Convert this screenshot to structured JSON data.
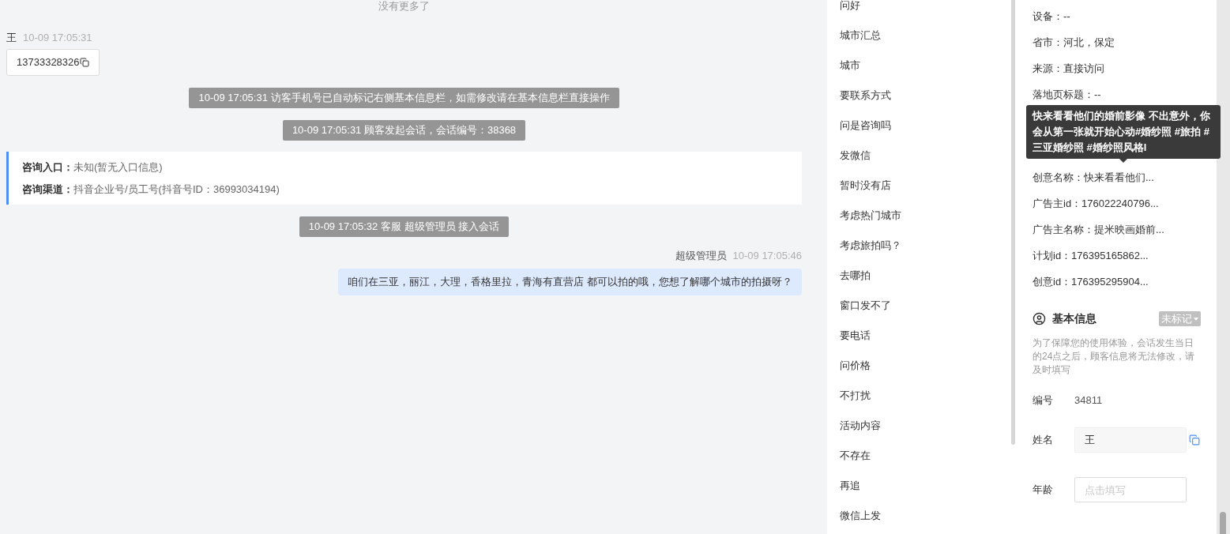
{
  "chat": {
    "notice": "没有更多了",
    "messages": [
      {
        "kind": "visitor",
        "name": "王",
        "time": "10-09 17:05:31",
        "text": "13733328326"
      },
      {
        "kind": "system",
        "text": "10-09 17:05:31 访客手机号已自动标记右侧基本信息栏，如需修改请在基本信息栏直接操作"
      },
      {
        "kind": "system",
        "text": "10-09 17:05:31 顾客发起会话，会话编号：38368"
      },
      {
        "kind": "info",
        "lines": [
          {
            "label": "咨询入口：",
            "value": "未知(暂无入口信息)"
          },
          {
            "label": "咨询渠道：",
            "value": "抖音企业号/员工号(抖音号ID：36993034194)"
          }
        ]
      },
      {
        "kind": "system",
        "text": "10-09 17:05:32 客服 超级管理员 接入会话"
      },
      {
        "kind": "agent",
        "name": "超级管理员",
        "time": "10-09 17:05:46",
        "text": "咱们在三亚，丽江，大理，香格里拉，青海有直营店 都可以拍的哦，您想了解哪个城市的拍摄呀？"
      }
    ]
  },
  "quick_replies": [
    "问好",
    "城市汇总",
    "城市",
    "要联系方式",
    "问是咨询吗",
    "发微信",
    "暂时没有店",
    "考虑热门城市",
    "考虑旅拍吗？",
    "去哪拍",
    "窗口发不了",
    "要电话",
    "问价格",
    "不打扰",
    "活动内容",
    "不存在",
    "再追",
    "微信上发"
  ],
  "profile": {
    "meta_top": [
      "设备：--",
      "省市：河北，保定",
      "来源：直接访问",
      "落地页标题：--"
    ],
    "meta_bottom": [
      "创意名称：快来看看他们...",
      "广告主id：176022240796...",
      "广告主名称：提米映画婚前...",
      "计划id：176395165862...",
      "创意id：176395295904..."
    ],
    "tooltip": "快来看看他们的婚前影像 不出意外，你会从第一张就开始心动#婚纱照 #旅拍 #三亚婚纱照 #婚纱照风格l",
    "section": {
      "title": "基本信息",
      "tag": "未标记",
      "note": "为了保障您的使用体验，会话发生当日的24点之后，顾客信息将无法修改，请及时填写",
      "fields": [
        {
          "kind": "text",
          "label": "编号",
          "value": "34811"
        },
        {
          "kind": "filled",
          "label": "姓名",
          "value": "王",
          "copy": true
        },
        {
          "kind": "empty",
          "label": "年龄",
          "placeholder": "点击填写"
        }
      ]
    }
  }
}
